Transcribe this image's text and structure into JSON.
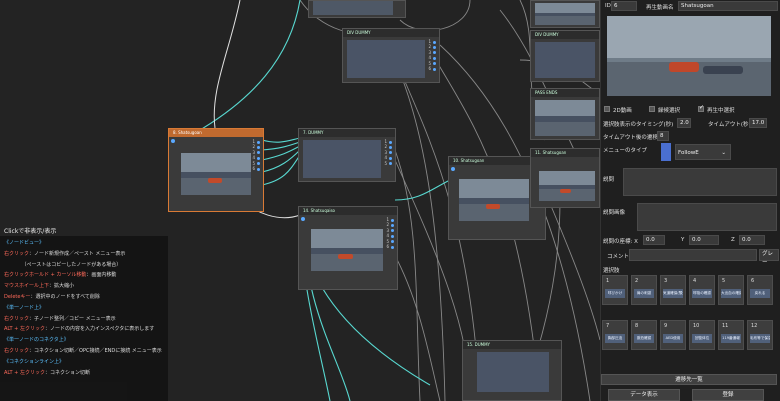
{
  "nodes": {
    "n_top_a": "",
    "n_top_b": "DIV DUMMY",
    "n_right_top": "DIV DUMMY",
    "n_right_mid": "PASS ENDS",
    "n_selected": "8. Shatsugoan",
    "n_dummy_c": "7. DUMMY",
    "n_shatsugoan2": "10. Shatsugoan",
    "n_shatsugoan3": "11. Shatsugoan",
    "n_shatsuqaiso": "14. Shatsuqaiso",
    "n_dummy_low": "15. DUMMY",
    "ports": [
      "1",
      "2",
      "3",
      "4",
      "5",
      "6"
    ]
  },
  "help": {
    "toggle": "Clickで非表示/表示",
    "lines": [
      {
        "k": "sec",
        "t": "《ノードビュー》"
      },
      {
        "k": "key",
        "t": "右クリック",
        "r": "：ノード新規作成／ペースト メニュー表示"
      },
      {
        "k": "txt",
        "t": "　　　　（ペーストはコピーしたノードがある場合）"
      },
      {
        "k": "key",
        "t": "右クリックホールド + カーソル移動",
        "r": "：画面内移動"
      },
      {
        "k": "key",
        "t": "マウスホイール上下",
        "r": "：拡大縮小"
      },
      {
        "k": "key",
        "t": "Deleteキー",
        "r": "：選択中のノードをすべて削除"
      },
      {
        "k": "sec",
        "t": "《単一ノード上》"
      },
      {
        "k": "key",
        "t": "右クリック",
        "r": "：子ノード整列／コピー メニュー表示"
      },
      {
        "k": "key",
        "t": "ALT + 左クリック",
        "r": "：ノードの内容を入力インスペクタに表示します"
      },
      {
        "k": "sec",
        "t": "《単一ノードのコネクタ上》"
      },
      {
        "k": "key",
        "t": "右クリック",
        "r": "：コネクション切断／OPC接続／ENDに接続 メニュー表示"
      },
      {
        "k": "sec",
        "t": "《コネクションライン上》"
      },
      {
        "k": "key",
        "t": "ALT + 左クリック",
        "r": "：コネクション切断"
      }
    ]
  },
  "panel": {
    "id_label": "ID",
    "id_value": "6",
    "video_label": "再生動画名",
    "video_value": "Shatsugoan",
    "cb_2d": "2D動画",
    "cb_2d_on": false,
    "cb_recommend": "繰候選択",
    "cb_recommend_on": false,
    "cb_playing": "再生中選択",
    "cb_playing_on": true,
    "timing_label": "選択肢表示のタイミング(秒)",
    "timing_value": "2.0",
    "timeout_label": "タイムアウト(秒)",
    "timeout_value": "17.0",
    "after_label": "タイムアウト後の遷移",
    "after_value": "8",
    "menu_type_label": "メニューのタイプ",
    "menu_type_value": "FollowE",
    "desc_label": "説問",
    "desc_img_label": "説問画像",
    "coord_label": "説問の座標: X",
    "x": "0.0",
    "y_label": "Y",
    "y": "0.0",
    "z_label": "Z",
    "z": "0.0",
    "comment_label": "コメント",
    "color_value": "グレー",
    "choices_label": "選択肢",
    "choices": [
      {
        "n": "1",
        "t": "呼びかけ"
      },
      {
        "n": "2",
        "t": "肩の刺激"
      },
      {
        "n": "3",
        "t": "気道確保(顎先)"
      },
      {
        "n": "4",
        "t": "呼吸の確認"
      },
      {
        "n": "5",
        "t": "大出血の確認"
      },
      {
        "n": "6",
        "t": "戻れる"
      },
      {
        "n": "7",
        "t": "胸部圧迫"
      },
      {
        "n": "8",
        "t": "脈拍確認"
      },
      {
        "n": "9",
        "t": "AED使用"
      },
      {
        "n": "10",
        "t": "回復体位"
      },
      {
        "n": "11",
        "t": "119番通報"
      },
      {
        "n": "12",
        "t": "毛布等で保温(ショック対応)"
      }
    ],
    "transitions_btn": "遷移先一覧",
    "data_btn": "データ表示",
    "save_btn": "登録"
  }
}
